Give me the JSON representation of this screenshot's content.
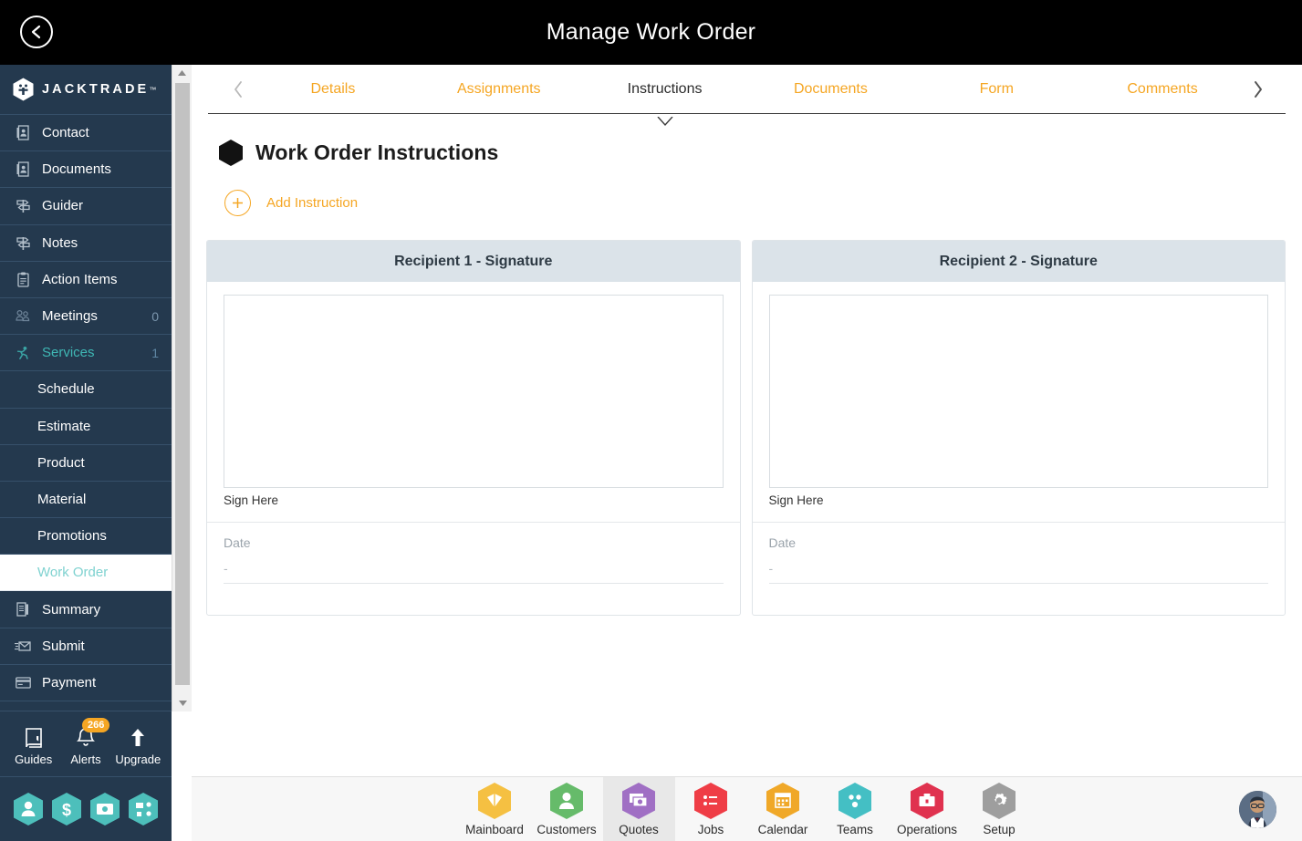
{
  "header": {
    "title": "Manage Work Order",
    "back_icon": "chevron-left-circle-icon"
  },
  "sidebar": {
    "brand": {
      "name": "JACKTRADE",
      "tm": "™",
      "icon": "jacktrade-hex-logo"
    },
    "items": [
      {
        "label": "Contact",
        "icon": "contact-card-icon",
        "count": ""
      },
      {
        "label": "Documents",
        "icon": "document-icon",
        "count": ""
      },
      {
        "label": "Guider",
        "icon": "signpost-icon",
        "count": ""
      },
      {
        "label": "Notes",
        "icon": "signpost-icon",
        "count": ""
      },
      {
        "label": "Action Items",
        "icon": "clipboard-icon",
        "count": ""
      },
      {
        "label": "Meetings",
        "icon": "meetings-icon",
        "count": "0"
      },
      {
        "label": "Services",
        "icon": "services-runner-icon",
        "count": "1"
      }
    ],
    "sub_items": [
      {
        "label": "Schedule"
      },
      {
        "label": "Estimate"
      },
      {
        "label": "Product"
      },
      {
        "label": "Material"
      },
      {
        "label": "Promotions"
      },
      {
        "label": "Work Order"
      }
    ],
    "tail_items": [
      {
        "label": "Summary",
        "icon": "summary-book-icon"
      },
      {
        "label": "Submit",
        "icon": "submit-envelope-icon"
      },
      {
        "label": "Payment",
        "icon": "payment-card-icon"
      }
    ],
    "tools": [
      {
        "label": "Guides",
        "icon": "book-icon",
        "badge": ""
      },
      {
        "label": "Alerts",
        "icon": "bell-icon",
        "badge": "266"
      },
      {
        "label": "Upgrade",
        "icon": "up-arrow-icon",
        "badge": ""
      }
    ],
    "quick_hexes": [
      {
        "icon": "user-hex-icon",
        "color": "#4dbfbb"
      },
      {
        "icon": "dollar-hex-icon",
        "color": "#4dbfbb"
      },
      {
        "icon": "invoice-hex-icon",
        "color": "#4dbfbb"
      },
      {
        "icon": "workflow-hex-icon",
        "color": "#4dbfbb"
      }
    ]
  },
  "main": {
    "tabs": [
      {
        "label": "Details",
        "active": false
      },
      {
        "label": "Assignments",
        "active": false
      },
      {
        "label": "Instructions",
        "active": true
      },
      {
        "label": "Documents",
        "active": false
      },
      {
        "label": "Form",
        "active": false
      },
      {
        "label": "Comments",
        "active": false
      }
    ],
    "prev_icon": "chevron-left-icon",
    "next_icon": "chevron-right-icon",
    "page_title": "Work Order Instructions",
    "page_icon": "black-hex-icon",
    "add_instruction": {
      "label": "Add Instruction",
      "icon": "plus-circle-icon"
    },
    "cards": [
      {
        "title": "Recipient 1 - Signature",
        "sign_label": "Sign Here",
        "date_label": "Date",
        "date_value": "-"
      },
      {
        "title": "Recipient 2 - Signature",
        "sign_label": "Sign Here",
        "date_label": "Date",
        "date_value": "-"
      }
    ]
  },
  "bottom_nav": {
    "items": [
      {
        "label": "Mainboard",
        "icon": "mainboard-hex-icon",
        "color": "#f5c042",
        "active": false
      },
      {
        "label": "Customers",
        "icon": "customers-hex-icon",
        "color": "#66bb6a",
        "active": false
      },
      {
        "label": "Quotes",
        "icon": "quotes-hex-icon",
        "color": "#a06fc4",
        "active": true
      },
      {
        "label": "Jobs",
        "icon": "jobs-hex-icon",
        "color": "#ef3d46",
        "active": false
      },
      {
        "label": "Calendar",
        "icon": "calendar-hex-icon",
        "color": "#f0a828",
        "active": false
      },
      {
        "label": "Teams",
        "icon": "teams-hex-icon",
        "color": "#44bfc4",
        "active": false
      },
      {
        "label": "Operations",
        "icon": "operations-hex-icon",
        "color": "#e0324f",
        "active": false
      },
      {
        "label": "Setup",
        "icon": "setup-gear-hex-icon",
        "color": "#9e9e9e",
        "active": false
      }
    ],
    "avatar": "user-avatar"
  },
  "colors": {
    "sidebar_bg": "#24394e",
    "accent_orange": "#f5a623",
    "accent_teal": "#3fb8b5",
    "card_head_bg": "#dbe3e9",
    "topbar_bg": "#000000"
  }
}
